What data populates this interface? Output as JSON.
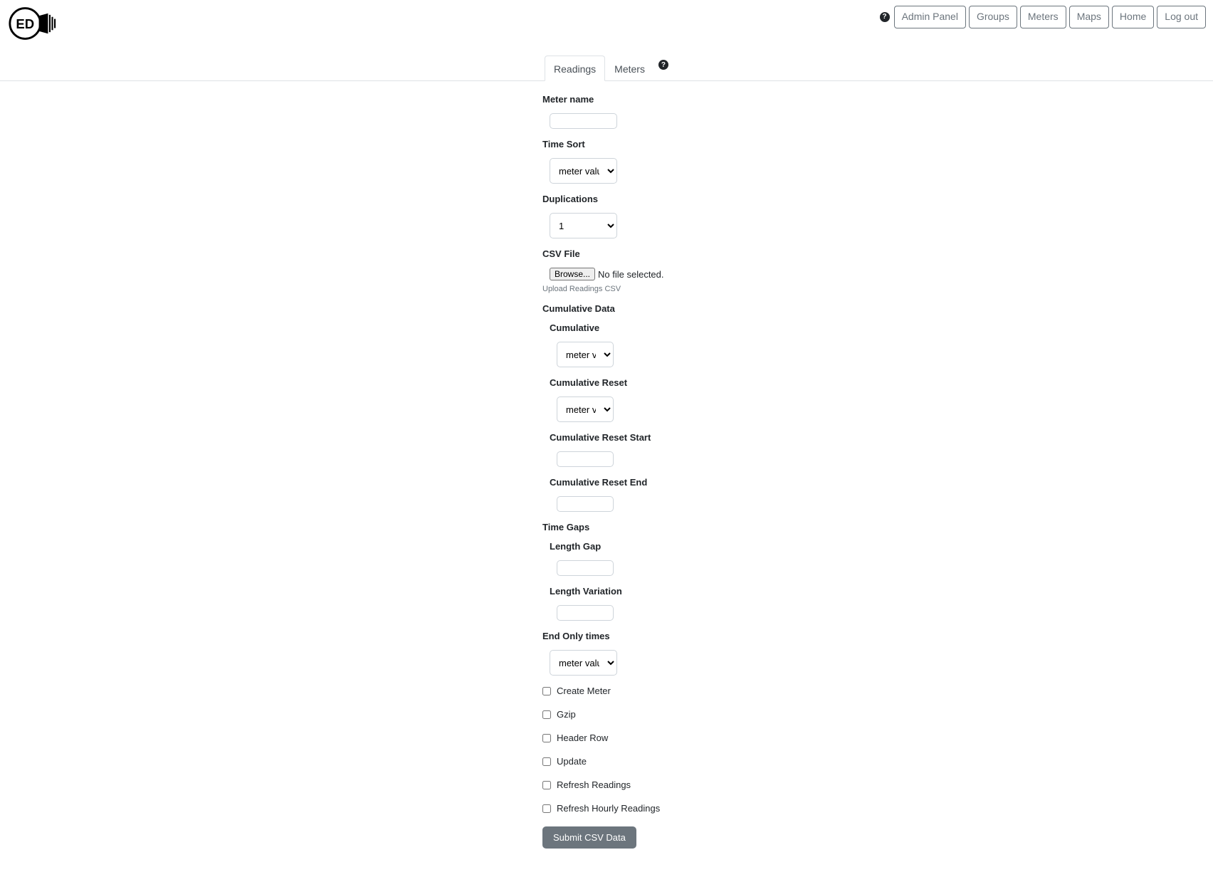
{
  "nav": {
    "admin_panel": "Admin Panel",
    "groups": "Groups",
    "meters": "Meters",
    "maps": "Maps",
    "home": "Home",
    "logout": "Log out"
  },
  "tabs": {
    "readings": "Readings",
    "meters": "Meters"
  },
  "form": {
    "meter_name_label": "Meter name",
    "time_sort_label": "Time Sort",
    "time_sort_value": "meter value or default",
    "duplications_label": "Duplications",
    "duplications_value": "1",
    "csv_file_label": "CSV File",
    "browse_label": "Browse...",
    "no_file_selected": "No file selected.",
    "upload_hint": "Upload Readings CSV",
    "cumulative_data_label": "Cumulative Data",
    "cumulative_label": "Cumulative",
    "cumulative_value": "meter value or default",
    "cumulative_reset_label": "Cumulative Reset",
    "cumulative_reset_value": "meter value or default",
    "cumulative_reset_start_label": "Cumulative Reset Start",
    "cumulative_reset_end_label": "Cumulative Reset End",
    "time_gaps_label": "Time Gaps",
    "length_gap_label": "Length Gap",
    "length_variation_label": "Length Variation",
    "end_only_times_label": "End Only times",
    "end_only_times_value": "meter value or default",
    "create_meter_label": "Create Meter",
    "gzip_label": "Gzip",
    "header_row_label": "Header Row",
    "update_label": "Update",
    "refresh_readings_label": "Refresh Readings",
    "refresh_hourly_label": "Refresh Hourly Readings",
    "submit_label": "Submit CSV Data"
  }
}
